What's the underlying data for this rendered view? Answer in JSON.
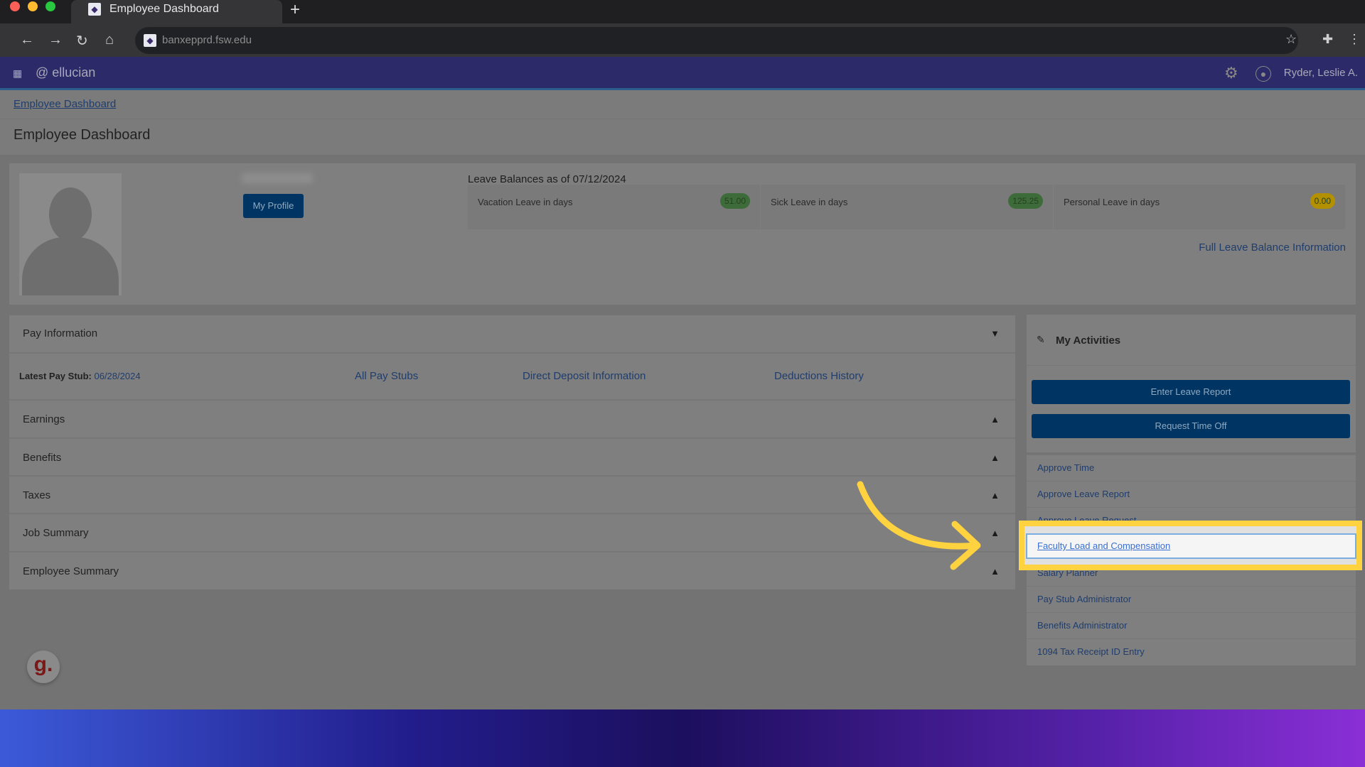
{
  "browser": {
    "tab_title": "Employee Dashboard",
    "new_tab": "+",
    "url": "banxepprd.fsw.edu"
  },
  "app": {
    "brand": "ellucian",
    "user": "Ryder, Leslie A."
  },
  "breadcrumb": "Employee Dashboard",
  "page_title": "Employee Dashboard",
  "profile": {
    "button": "My Profile"
  },
  "leave": {
    "heading": "Leave Balances as of 07/12/2024",
    "items": [
      {
        "label": "Vacation Leave in days",
        "value": "51.00",
        "color": "#3e6b3a"
      },
      {
        "label": "Sick Leave in days",
        "value": "125.25",
        "color": "#3e6b3a"
      },
      {
        "label": "Personal Leave in days",
        "value": "0.00",
        "color": "#b39000"
      }
    ],
    "full_link": "Full Leave Balance Information"
  },
  "pay": {
    "title": "Pay Information",
    "stub_label": "Latest Pay Stub:",
    "stub_date": "06/28/2024",
    "links": [
      "All Pay Stubs",
      "Direct Deposit Information",
      "Deductions History"
    ]
  },
  "sections": [
    "Earnings",
    "Benefits",
    "Taxes",
    "Job Summary",
    "Employee Summary"
  ],
  "activities": {
    "title": "My Activities",
    "buttons": [
      "Enter Leave Report",
      "Request Time Off"
    ],
    "items": [
      "Approve Time",
      "Approve Leave Report",
      "Approve Leave Request",
      "Faculty Load and Compensation",
      "Salary Planner",
      "Pay Stub Administrator",
      "Benefits Administrator",
      "1094 Tax Receipt ID Entry"
    ],
    "highlighted": "Faculty Load and Compensation"
  },
  "highlight_color": "#ffd240",
  "logo_letter": "g."
}
